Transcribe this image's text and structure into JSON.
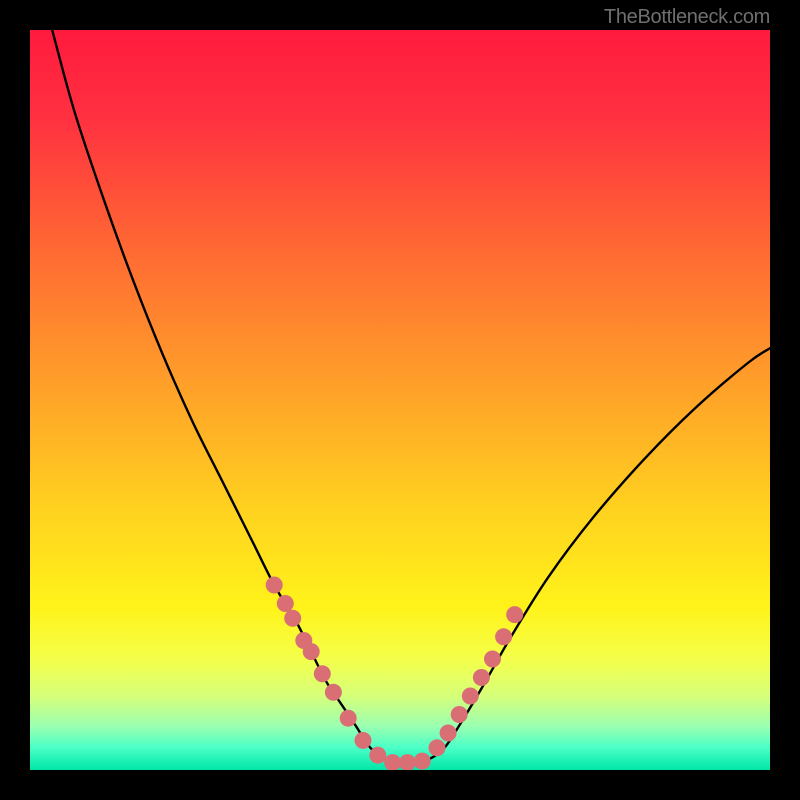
{
  "watermark": "TheBottleneck.com",
  "chart_data": {
    "type": "line",
    "title": "",
    "xlabel": "",
    "ylabel": "",
    "xlim": [
      0,
      100
    ],
    "ylim": [
      0,
      100
    ],
    "notes": "Bottleneck curve: V-shaped curve with minimum near center. Background is a vertical heat gradient from red (top, high bottleneck) through yellow to green (bottom, balanced). Axes are unlabeled in the source image.",
    "series": [
      {
        "name": "bottleneck-curve",
        "x": [
          3,
          6,
          10,
          14,
          18,
          22,
          26,
          30,
          33,
          36,
          38,
          40,
          42,
          44,
          46,
          48,
          50,
          52,
          54,
          56,
          58,
          61,
          65,
          70,
          76,
          83,
          90,
          97,
          100
        ],
        "y": [
          100,
          89,
          77,
          66,
          56,
          47,
          39,
          31,
          25,
          20,
          16,
          12,
          9,
          6,
          3,
          1.5,
          1,
          1,
          1.5,
          3,
          6,
          11,
          18,
          26,
          34,
          42,
          49,
          55,
          57
        ]
      }
    ],
    "markers": {
      "name": "highlight-dots",
      "color": "#d96f75",
      "points_x": [
        33,
        34.5,
        35.5,
        37,
        38,
        39.5,
        41,
        43,
        45,
        47,
        49,
        51,
        53,
        55,
        56.5,
        58,
        59.5,
        61,
        62.5,
        64,
        65.5
      ],
      "points_y": [
        25,
        22.5,
        20.5,
        17.5,
        16,
        13,
        10.5,
        7,
        4,
        2,
        1,
        1,
        1.2,
        3,
        5,
        7.5,
        10,
        12.5,
        15,
        18,
        21
      ]
    },
    "gradient_stops": [
      {
        "offset": 0.0,
        "color": "#ff1a3e"
      },
      {
        "offset": 0.12,
        "color": "#ff3140"
      },
      {
        "offset": 0.3,
        "color": "#ff6a33"
      },
      {
        "offset": 0.48,
        "color": "#ffa029"
      },
      {
        "offset": 0.65,
        "color": "#ffd21f"
      },
      {
        "offset": 0.78,
        "color": "#fff31a"
      },
      {
        "offset": 0.85,
        "color": "#f4ff4a"
      },
      {
        "offset": 0.9,
        "color": "#d6ff7a"
      },
      {
        "offset": 0.94,
        "color": "#9cffb0"
      },
      {
        "offset": 0.97,
        "color": "#4affc6"
      },
      {
        "offset": 1.0,
        "color": "#00e6a8"
      }
    ]
  }
}
